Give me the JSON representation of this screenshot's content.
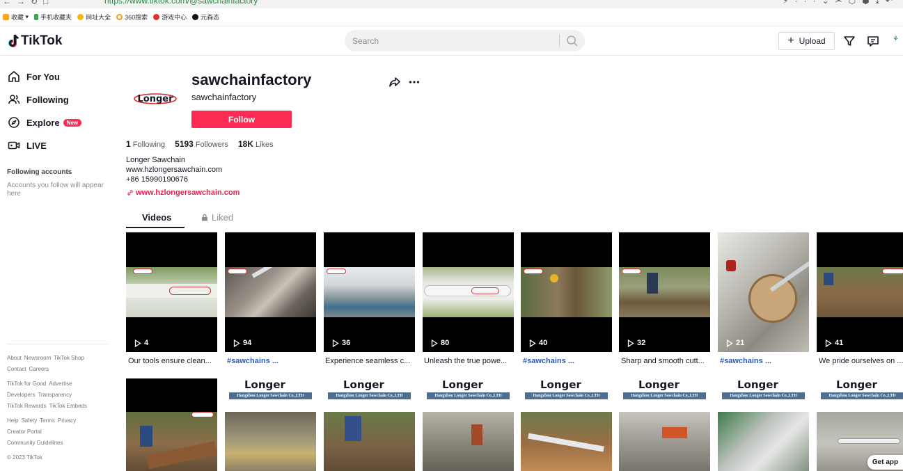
{
  "browser": {
    "url": "https://www.tiktok.com/@sawchainfactory",
    "bookmarks": [
      "收藏",
      "手机收藏夹",
      "网址大全",
      "360搜索",
      "游戏中心",
      "元森态"
    ]
  },
  "header": {
    "logo": "TikTok",
    "search_placeholder": "Search",
    "upload_label": "Upload"
  },
  "sidebar": {
    "nav": [
      {
        "label": "For You",
        "icon": "home-icon"
      },
      {
        "label": "Following",
        "icon": "users-icon"
      },
      {
        "label": "Explore",
        "icon": "compass-icon",
        "badge": "New"
      },
      {
        "label": "LIVE",
        "icon": "live-icon"
      }
    ],
    "following_title": "Following accounts",
    "following_hint": "Accounts you follow will appear here",
    "footer": [
      [
        "About",
        "Newsroom",
        "TikTok Shop"
      ],
      [
        "Contact",
        "Careers"
      ],
      [
        "TikTok for Good",
        "Advertise"
      ],
      [
        "Developers",
        "Transparency"
      ],
      [
        "TikTok Rewards",
        "TikTok Embeds"
      ],
      [
        "Help",
        "Safety",
        "Terms",
        "Privacy"
      ],
      [
        "Creator Portal"
      ],
      [
        "Community Guidelines"
      ],
      [
        "© 2023 TikTok"
      ]
    ]
  },
  "profile": {
    "avatar_text": "Longer",
    "username": "sawchainfactory",
    "nickname": "sawchainfactory",
    "follow_label": "Follow",
    "stats": [
      {
        "value": "1",
        "label": "Following"
      },
      {
        "value": "5193",
        "label": "Followers"
      },
      {
        "value": "18K",
        "label": "Likes"
      }
    ],
    "bio": [
      "Longer Sawchain",
      "www.hzlongersawchain.com",
      "+86 15990190676"
    ],
    "link": "www.hzlongersawchain.com"
  },
  "tabs": {
    "videos": "Videos",
    "liked": "Liked"
  },
  "videos": [
    {
      "plays": "4",
      "caption": "Our tools ensure clean...",
      "is_tag": false
    },
    {
      "plays": "94",
      "caption": "#sawchains ...",
      "is_tag": true
    },
    {
      "plays": "36",
      "caption": "Experience seamless c...",
      "is_tag": false
    },
    {
      "plays": "80",
      "caption": "Unleash the true powe...",
      "is_tag": false
    },
    {
      "plays": "40",
      "caption": "#sawchains ...",
      "is_tag": true
    },
    {
      "plays": "32",
      "caption": "Sharp and smooth cutt...",
      "is_tag": false
    },
    {
      "plays": "21",
      "caption": "#sawchains ...",
      "is_tag": true
    },
    {
      "plays": "41",
      "caption": "We pride ourselves on ...",
      "is_tag": false
    }
  ],
  "row2": {
    "brand": "Longer",
    "company": "Hangzhou Longer Sawchain Co.,LTD"
  },
  "get_app": "Get app"
}
